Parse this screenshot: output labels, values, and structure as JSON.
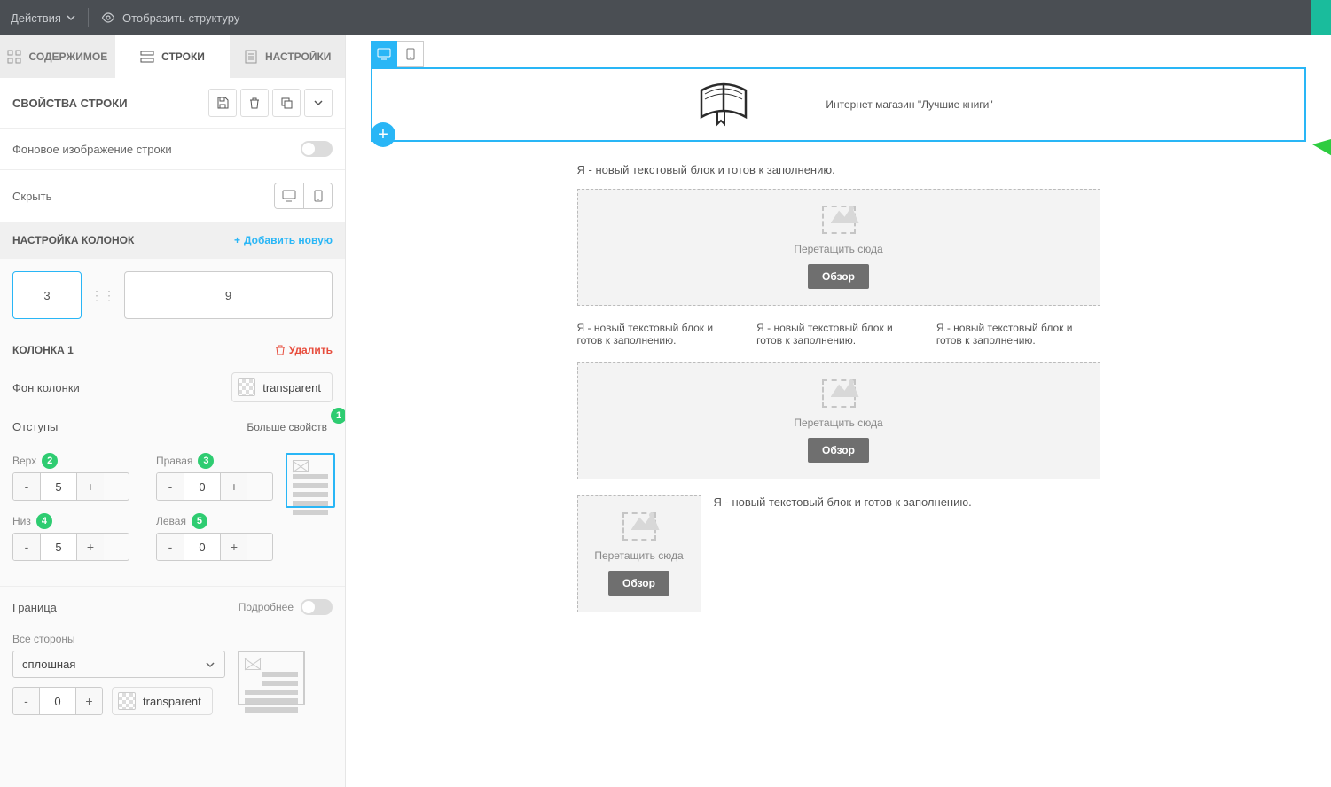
{
  "topbar": {
    "actions": "Действия",
    "show_structure": "Отобразить структуру"
  },
  "tabs": {
    "content": "СОДЕРЖИМОЕ",
    "rows": "СТРОКИ",
    "settings": "НАСТРОЙКИ"
  },
  "row_props": {
    "title": "СВОЙСТВА СТРОКИ",
    "bg_image": "Фоновое изображение строки",
    "hide": "Скрыть"
  },
  "columns": {
    "title": "НАСТРОЙКА КОЛОНОК",
    "add": "Добавить новую",
    "w1": "3",
    "w2": "9"
  },
  "col1": {
    "title": "КОЛОНКА 1",
    "delete": "Удалить",
    "bg_label": "Фон колонки",
    "bg_value": "transparent"
  },
  "padding": {
    "label": "Отступы",
    "more": "Больше свойств",
    "top_label": "Верх",
    "right_label": "Правая",
    "bottom_label": "Низ",
    "left_label": "Левая",
    "top": "5",
    "right": "0",
    "bottom": "5",
    "left": "0"
  },
  "border": {
    "label": "Граница",
    "more": "Подробнее",
    "all_sides": "Все стороны",
    "style": "сплошная",
    "width": "0",
    "color": "transparent"
  },
  "badges": {
    "b1": "1",
    "b2": "2",
    "b3": "3",
    "b4": "4",
    "b5": "5"
  },
  "canvas": {
    "store_name": "Интернет магазин \"Лучшие книги\"",
    "new_text": "Я - новый текстовый блок и готов к заполнению.",
    "drop_label": "Перетащить сюда",
    "browse": "Обзор"
  }
}
